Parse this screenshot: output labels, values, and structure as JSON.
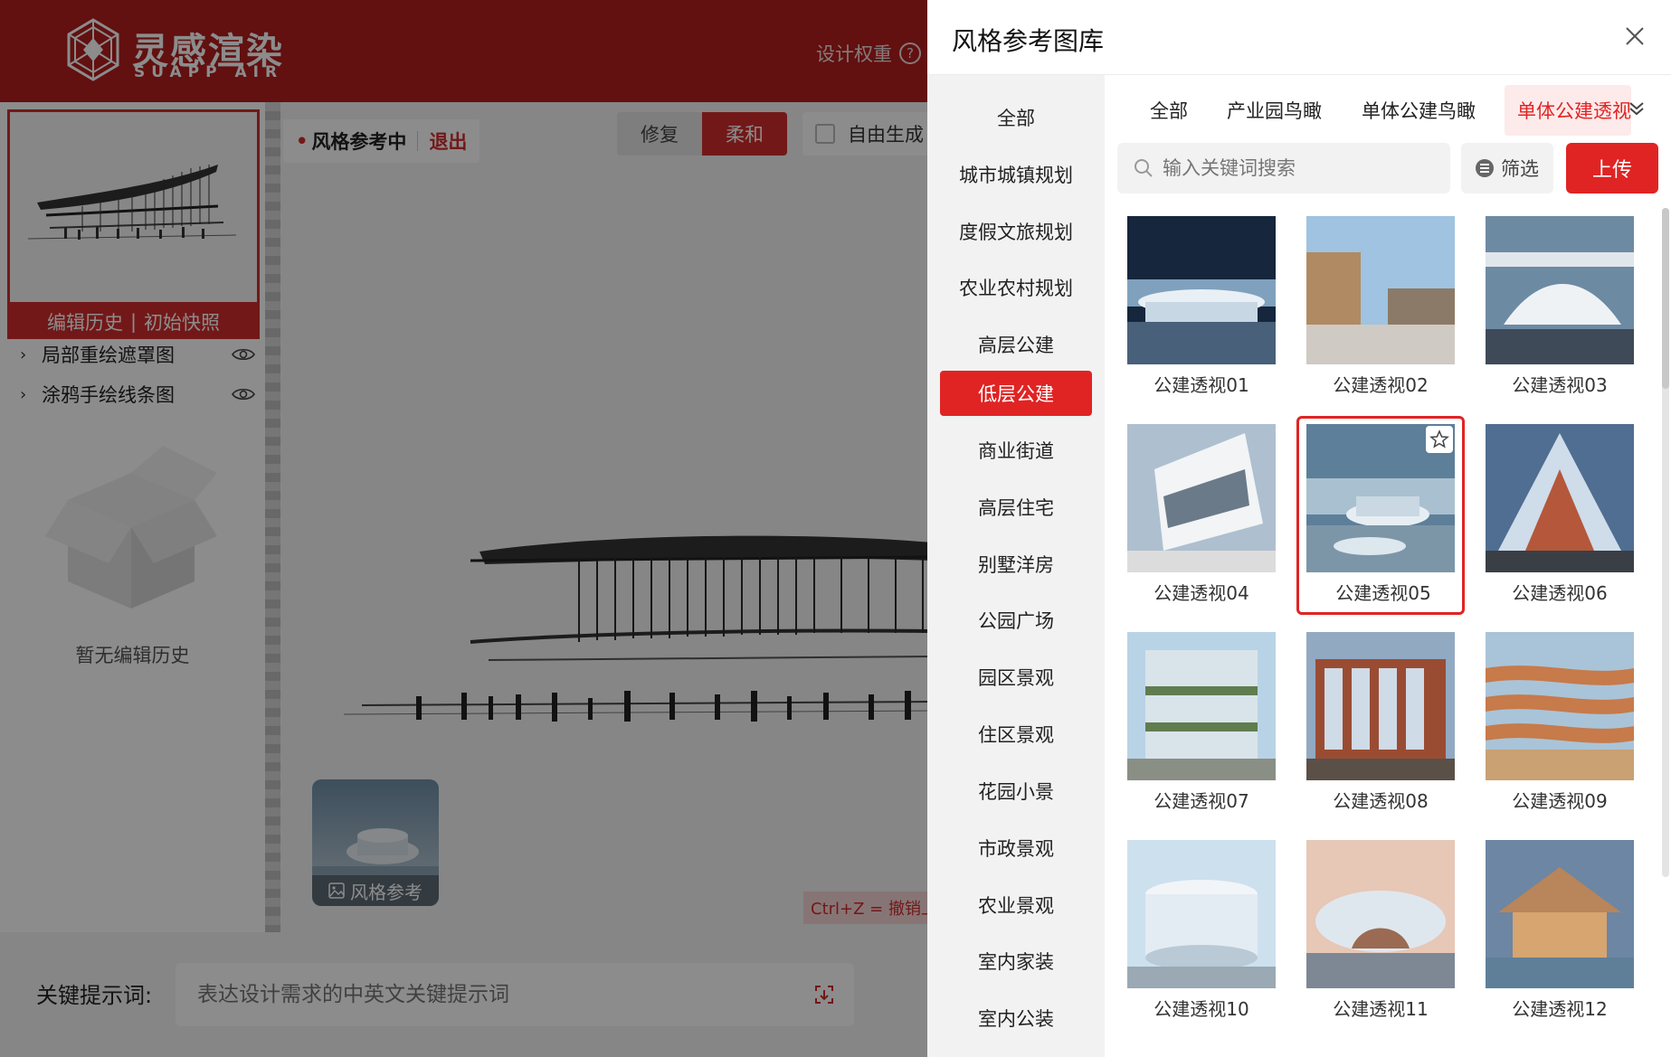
{
  "app": {
    "logo_cn": "灵感渲染",
    "logo_en": "SUAPP AIR",
    "design_weight": "设计权重",
    "help_glyph": "?"
  },
  "left_panel": {
    "history_tab": "编辑历史",
    "snapshot_tab": "初始快照",
    "tab_separator": "|",
    "layers": [
      {
        "label": "局部重绘遮罩图"
      },
      {
        "label": "涂鸦手绘线条图"
      }
    ],
    "empty_text": "暂无编辑历史"
  },
  "canvas": {
    "ref_tag": "风格参考中",
    "ref_exit": "退出",
    "modes": [
      "修复",
      "柔和"
    ],
    "active_mode": "柔和",
    "free_gen": "自由生成",
    "style_thumb_label": "风格参考",
    "undo_hint": "Ctrl+Z = 撤销上"
  },
  "bottom": {
    "keyword_label": "关键提示词:",
    "keyword_placeholder": "表达设计需求的中英文关键提示词"
  },
  "drawer": {
    "title": "风格参考图库",
    "categories": [
      "全部",
      "城市城镇规划",
      "度假文旅规划",
      "农业农村规划",
      "高层公建",
      "低层公建",
      "商业街道",
      "高层住宅",
      "别墅洋房",
      "公园广场",
      "园区景观",
      "住区景观",
      "花园小景",
      "市政景观",
      "农业景观",
      "室内家装",
      "室内公装"
    ],
    "active_category": "低层公建",
    "sub_tabs": [
      "全部",
      "产业园鸟瞰",
      "单体公建鸟瞰",
      "单体公建透视"
    ],
    "active_sub_tab": "单体公建透视",
    "search_placeholder": "输入关键词搜索",
    "filter_label": "筛选",
    "upload_label": "上传",
    "images": [
      {
        "caption": "公建透视01"
      },
      {
        "caption": "公建透视02"
      },
      {
        "caption": "公建透视03"
      },
      {
        "caption": "公建透视04"
      },
      {
        "caption": "公建透视05"
      },
      {
        "caption": "公建透视06"
      },
      {
        "caption": "公建透视07"
      },
      {
        "caption": "公建透视08"
      },
      {
        "caption": "公建透视09"
      },
      {
        "caption": "公建透视10"
      },
      {
        "caption": "公建透视11"
      },
      {
        "caption": "公建透视12"
      }
    ],
    "selected_image": "公建透视05"
  },
  "colors": {
    "brand_red": "#b21e1e",
    "accent_red": "#e02424",
    "active_tab_bg": "#fdeaea"
  }
}
